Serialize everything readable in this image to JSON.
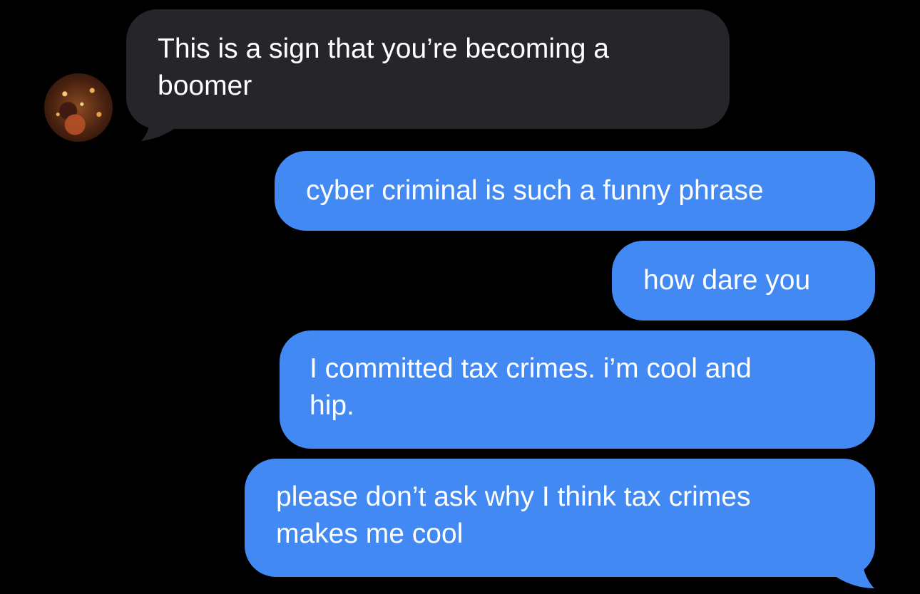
{
  "conversation": {
    "theme": {
      "background": "#000000",
      "incoming_bubble": "#26252a",
      "outgoing_bubble": "#4289f4",
      "text": "#ffffff"
    },
    "contact_avatar": "avatar-photo",
    "messages": [
      {
        "direction": "incoming",
        "lines": [
          "This is a sign that you’re becoming a",
          "boomer"
        ]
      },
      {
        "direction": "outgoing",
        "lines": [
          "cyber criminal is such a funny phrase"
        ]
      },
      {
        "direction": "outgoing",
        "lines": [
          "how dare you"
        ]
      },
      {
        "direction": "outgoing",
        "lines": [
          "I committed tax crimes. i’m cool and",
          "hip."
        ]
      },
      {
        "direction": "outgoing",
        "lines": [
          "please don’t ask why I think tax crimes",
          "makes me cool"
        ]
      }
    ]
  }
}
